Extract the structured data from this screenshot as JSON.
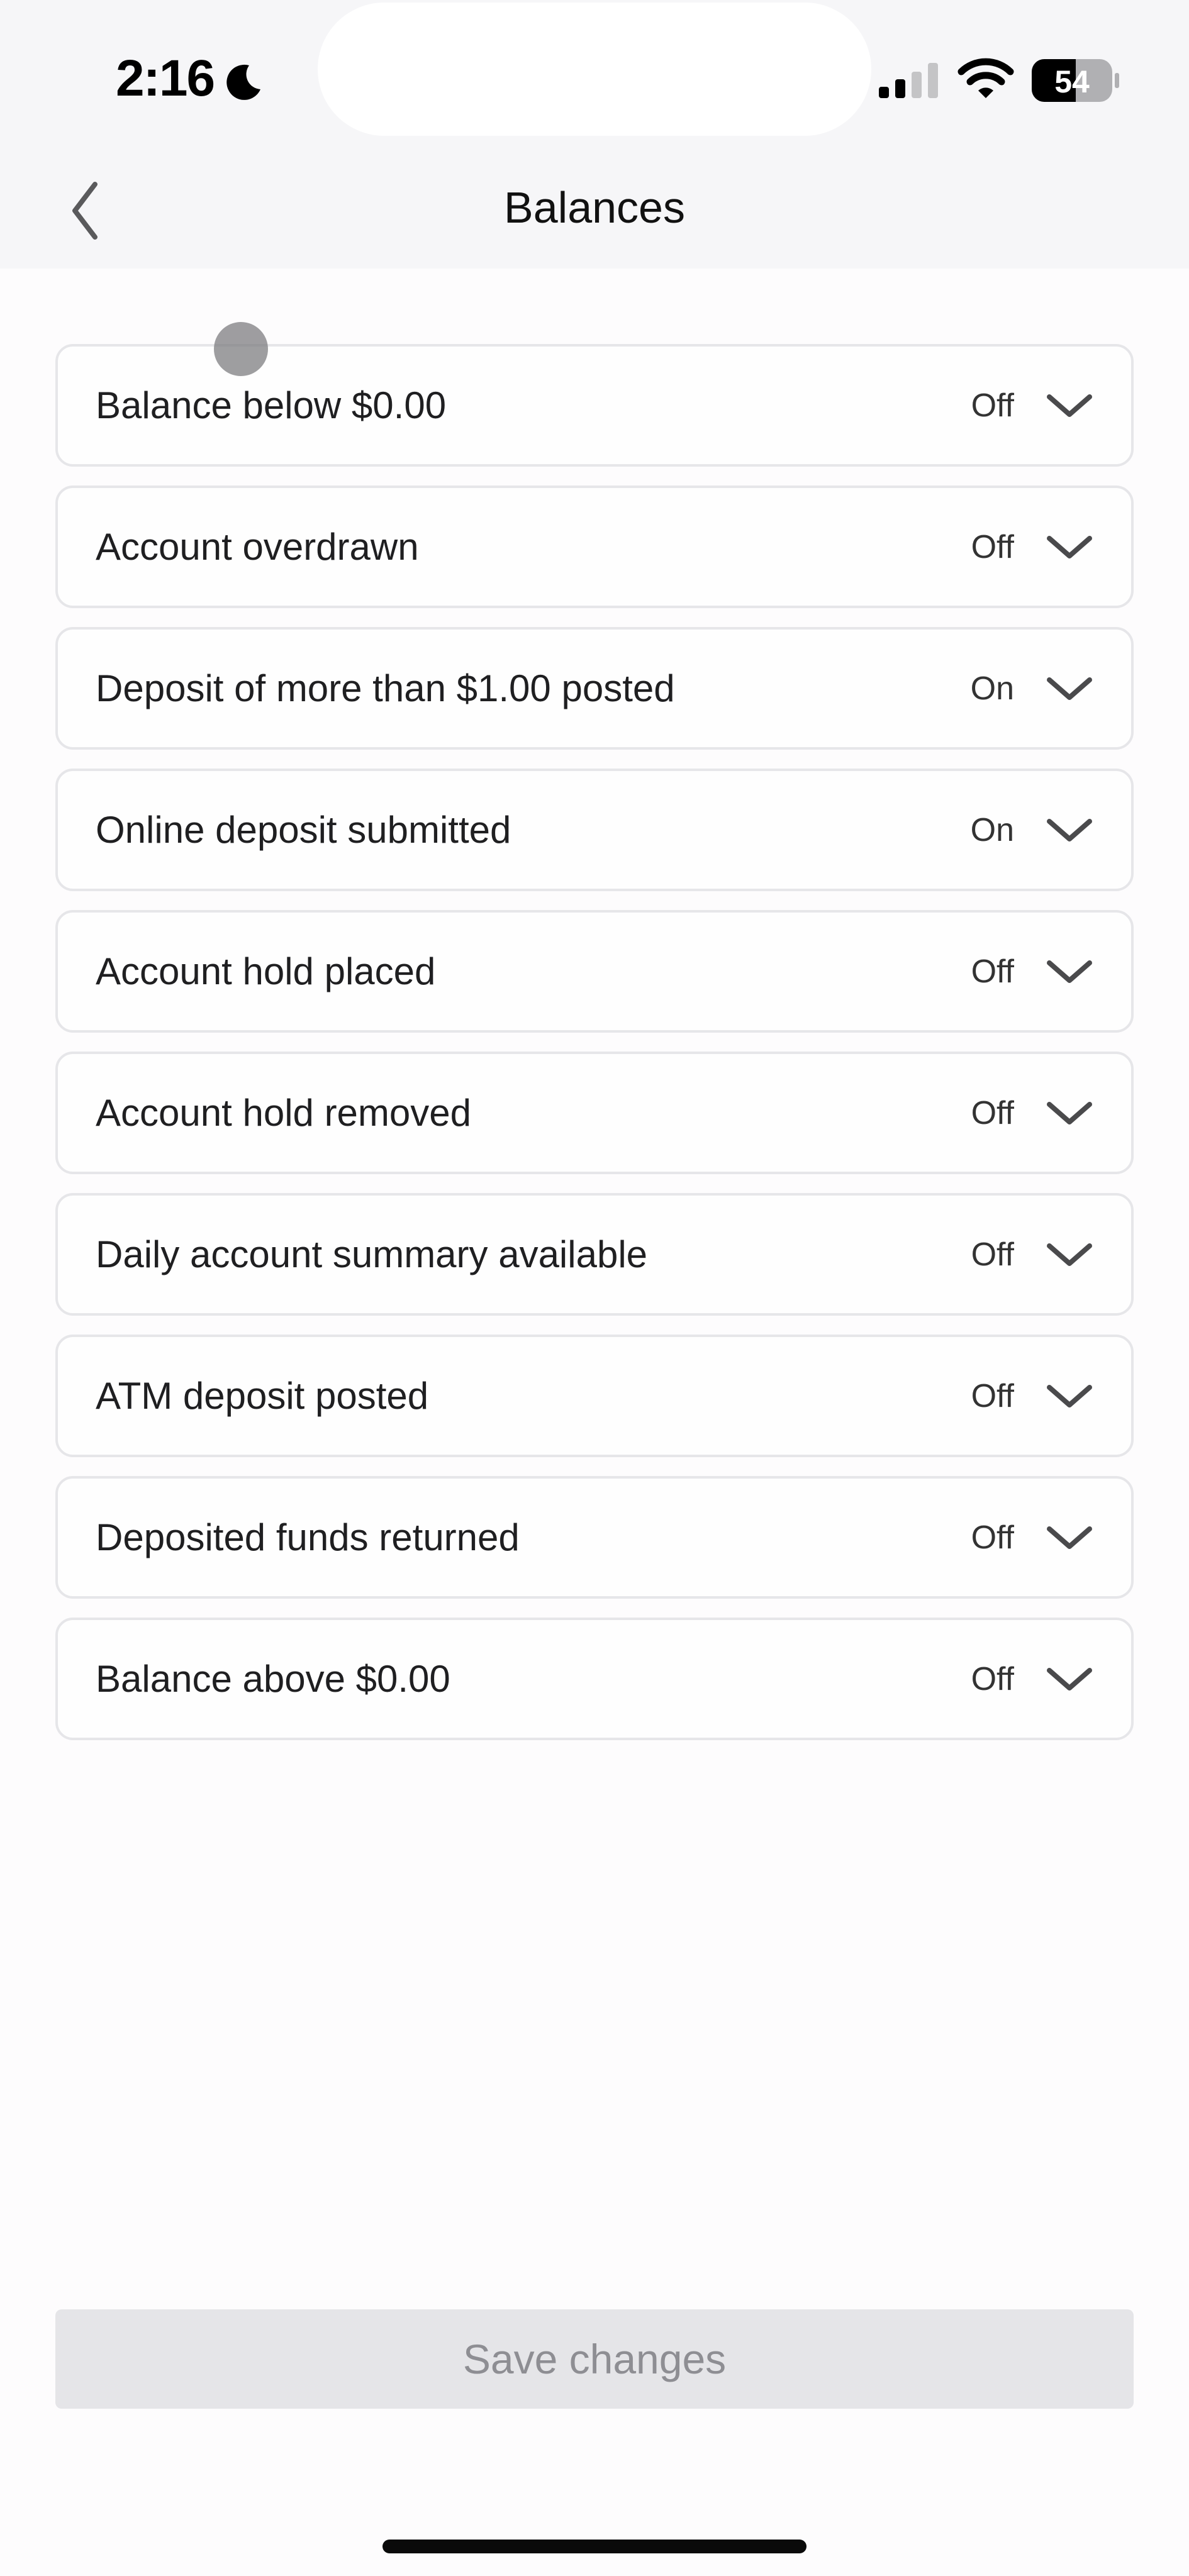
{
  "status_bar": {
    "time": "2:16",
    "focus_mode_icon": "moon-icon",
    "signal_icon": "cellular-signal-icon",
    "signal_bars_active": 2,
    "signal_bars_total": 4,
    "wifi_icon": "wifi-icon",
    "battery_icon": "battery-icon",
    "battery_level": "54"
  },
  "header": {
    "back_icon": "chevron-left-icon",
    "title": "Balances"
  },
  "alerts": [
    {
      "label": "Balance below $0.00",
      "status": "Off",
      "icon": "chevron-down-icon"
    },
    {
      "label": "Account overdrawn",
      "status": "Off",
      "icon": "chevron-down-icon"
    },
    {
      "label": "Deposit of more than $1.00 posted",
      "status": "On",
      "icon": "chevron-down-icon"
    },
    {
      "label": "Online deposit submitted",
      "status": "On",
      "icon": "chevron-down-icon"
    },
    {
      "label": "Account hold placed",
      "status": "Off",
      "icon": "chevron-down-icon"
    },
    {
      "label": "Account hold removed",
      "status": "Off",
      "icon": "chevron-down-icon"
    },
    {
      "label": "Daily account summary available",
      "status": "Off",
      "icon": "chevron-down-icon"
    },
    {
      "label": "ATM deposit posted",
      "status": "Off",
      "icon": "chevron-down-icon"
    },
    {
      "label": "Deposited funds returned",
      "status": "Off",
      "icon": "chevron-down-icon"
    },
    {
      "label": "Balance above $0.00",
      "status": "Off",
      "icon": "chevron-down-icon"
    }
  ],
  "footer": {
    "save_label": "Save changes",
    "save_enabled": false
  },
  "colors": {
    "header_bg": "#f6f6f8",
    "page_bg": "#fdfcfd",
    "card_border": "#e6e6e9",
    "button_disabled_bg": "#e5e5e8",
    "button_disabled_text": "#8e8e93",
    "chevron": "#4a4a4c"
  }
}
